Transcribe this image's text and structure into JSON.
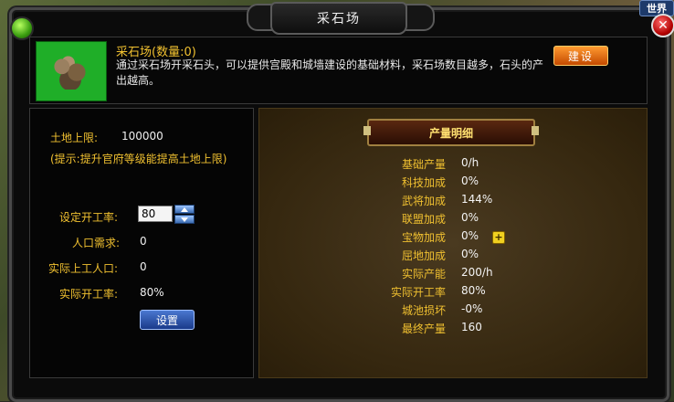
{
  "window": {
    "title": "采石场",
    "world_label": "世界",
    "close_label": "✕"
  },
  "info": {
    "title": "采石场(数量:0)",
    "description": "通过采石场开采石头，可以提供宫殿和城墙建设的基础材料，采石场数目越多，石头的产出越高。",
    "build_label": "建设"
  },
  "left": {
    "land_limit_label": "土地上限:",
    "land_limit_value": "100000",
    "hint": "(提示:提升官府等级能提高土地上限)",
    "set_rate_label": "设定开工率:",
    "set_rate_value": "80",
    "population_label": "人口需求:",
    "population_value": "0",
    "actual_workers_label": "实际上工人口:",
    "actual_workers_value": "0",
    "actual_rate_label": "实际开工率:",
    "actual_rate_value": "80%",
    "set_button_label": "设置"
  },
  "details": {
    "header": "产量明细",
    "rows": [
      {
        "label": "基础产量",
        "value": "0/h"
      },
      {
        "label": "科技加成",
        "value": "0%"
      },
      {
        "label": "武将加成",
        "value": "144%"
      },
      {
        "label": "联盟加成",
        "value": "0%"
      },
      {
        "label": "宝物加成",
        "value": "0%"
      },
      {
        "label": "屈地加成",
        "value": "0%"
      },
      {
        "label": "实际产能",
        "value": "200/h"
      },
      {
        "label": "实际开工率",
        "value": "80%"
      },
      {
        "label": "城池损坏",
        "value": "-0%"
      },
      {
        "label": "最终产量",
        "value": "160"
      }
    ],
    "plus_label": "+"
  }
}
